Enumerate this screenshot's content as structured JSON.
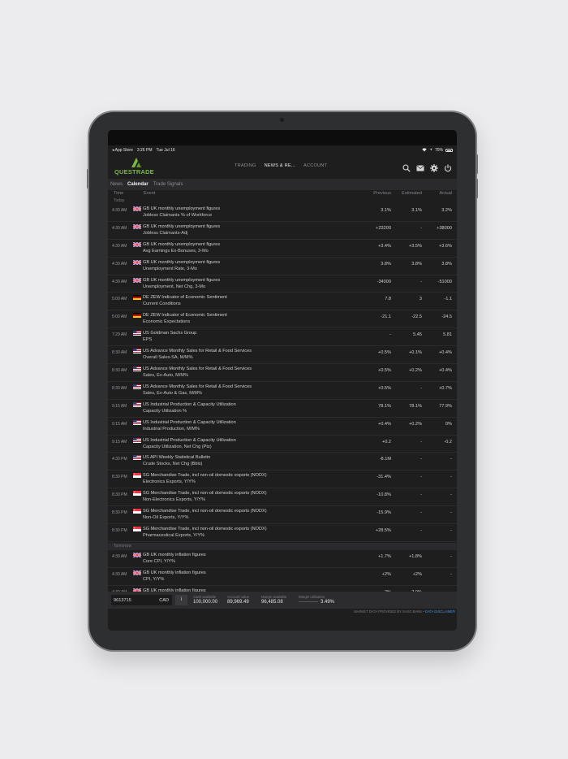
{
  "status": {
    "back_app": "◂ App Store",
    "time": "3:26 PM",
    "date": "Tue Jul 16",
    "battery": "75%"
  },
  "brand": {
    "logo_text": "QUESTRADE",
    "accent": "#7ab93e"
  },
  "nav": {
    "trading": "TRADING",
    "news": "NEWS & RE...",
    "account": "ACCOUNT"
  },
  "icons": [
    "search-icon",
    "mail-icon",
    "gear-icon",
    "power-icon"
  ],
  "subtabs": {
    "news": "News",
    "calendar": "Calendar",
    "signals": "Trade Signals"
  },
  "columns": {
    "time": "Time",
    "event": "Event",
    "previous": "Previous",
    "estimated": "Estimated",
    "actual": "Actual"
  },
  "sections": {
    "today": "Today",
    "tomorrow": "Tomorrow"
  },
  "today_rows": [
    {
      "time": "4:30 AM",
      "flag": "uk",
      "title": "GB UK monthly unemployment figures",
      "sub": "Jobless Claimants % of Workforce",
      "previous": "3.1%",
      "estimated": "3.1%",
      "actual": "3.2%"
    },
    {
      "time": "4:30 AM",
      "flag": "uk",
      "title": "GB UK monthly unemployment figures",
      "sub": "Jobless Claimants-Adj",
      "previous": "+23200",
      "estimated": "-",
      "actual": "+38000"
    },
    {
      "time": "4:30 AM",
      "flag": "uk",
      "title": "GB UK monthly unemployment figures",
      "sub": "Avg Earnings Ex-Bonuses, 3-Mo",
      "previous": "+3.4%",
      "estimated": "+3.5%",
      "actual": "+3.6%"
    },
    {
      "time": "4:30 AM",
      "flag": "uk",
      "title": "GB UK monthly unemployment figures",
      "sub": "Unemployment Rate, 3-Mo",
      "previous": "3.8%",
      "estimated": "3.8%",
      "actual": "3.8%"
    },
    {
      "time": "4:30 AM",
      "flag": "uk",
      "title": "GB UK monthly unemployment figures",
      "sub": "Unemployment, Net Chg, 3-Mo",
      "previous": "-34000",
      "estimated": "-",
      "actual": "-51000"
    },
    {
      "time": "5:00 AM",
      "flag": "de",
      "title": "DE ZEW Indicator of Economic Sentiment",
      "sub": "Current Conditions",
      "previous": "7.8",
      "estimated": "3",
      "actual": "-1.1"
    },
    {
      "time": "5:00 AM",
      "flag": "de",
      "title": "DE ZEW Indicator of Economic Sentiment",
      "sub": "Economic Expectations",
      "previous": "-21.1",
      "estimated": "-22.5",
      "actual": "-24.5"
    },
    {
      "time": "7:29 AM",
      "flag": "us",
      "title": "US Goldman Sachs Group",
      "sub": "EPS",
      "previous": "-",
      "estimated": "5.45",
      "actual": "5.81"
    },
    {
      "time": "8:30 AM",
      "flag": "us",
      "title": "US Advance Monthly Sales for Retail & Food Services",
      "sub": "Overall Sales-SA, M/M%",
      "previous": "+0.5%",
      "estimated": "+0.1%",
      "actual": "+0.4%"
    },
    {
      "time": "8:30 AM",
      "flag": "us",
      "title": "US Advance Monthly Sales for Retail & Food Services",
      "sub": "Sales, Ex-Auto, M/M%",
      "previous": "+0.5%",
      "estimated": "+0.2%",
      "actual": "+0.4%"
    },
    {
      "time": "8:30 AM",
      "flag": "us",
      "title": "US Advance Monthly Sales for Retail & Food Services",
      "sub": "Sales, Ex-Auto & Gas, M/M%",
      "previous": "+0.5%",
      "estimated": "-",
      "actual": "+0.7%"
    },
    {
      "time": "9:15 AM",
      "flag": "us",
      "title": "US Industrial Production & Capacity Utilization",
      "sub": "Capacity Utilization %",
      "previous": "78.1%",
      "estimated": "78.1%",
      "actual": "77.9%"
    },
    {
      "time": "9:15 AM",
      "flag": "us",
      "title": "US Industrial Production & Capacity Utilization",
      "sub": "Industrial Production, M/M%",
      "previous": "+0.4%",
      "estimated": "+0.2%",
      "actual": "0%"
    },
    {
      "time": "9:15 AM",
      "flag": "us",
      "title": "US Industrial Production & Capacity Utilization",
      "sub": "Capacity Utilization, Net Chg (Pts)",
      "previous": "+0.2",
      "estimated": "-",
      "actual": "-0.2"
    },
    {
      "time": "4:30 PM",
      "flag": "us",
      "title": "US API Weekly Statistical Bulletin",
      "sub": "Crude Stocks, Net Chg (Bbls)",
      "previous": "-8.1M",
      "estimated": "-",
      "actual": "-"
    },
    {
      "time": "8:30 PM",
      "flag": "sg",
      "title": "SG Merchandise Trade, incl non-oil domestic exports (NODX)",
      "sub": "Electronics Exports, Y/Y%",
      "previous": "-31.4%",
      "estimated": "-",
      "actual": "-"
    },
    {
      "time": "8:30 PM",
      "flag": "sg",
      "title": "SG Merchandise Trade, incl non-oil domestic exports (NODX)",
      "sub": "Non-Electronics Exports, Y/Y%",
      "previous": "-10.8%",
      "estimated": "-",
      "actual": "-"
    },
    {
      "time": "8:30 PM",
      "flag": "sg",
      "title": "SG Merchandise Trade, incl non-oil domestic exports (NODX)",
      "sub": "Non-Oil Exports, Y/Y%",
      "previous": "-15.9%",
      "estimated": "-",
      "actual": "-"
    },
    {
      "time": "8:30 PM",
      "flag": "sg",
      "title": "SG Merchandise Trade, incl non-oil domestic exports (NODX)",
      "sub": "Pharmaceutical Exports, Y/Y%",
      "previous": "+28.5%",
      "estimated": "-",
      "actual": "-"
    }
  ],
  "tomorrow_rows": [
    {
      "time": "4:30 AM",
      "flag": "uk",
      "title": "GB UK monthly inflation figures",
      "sub": "Core CPI, Y/Y%",
      "previous": "+1.7%",
      "estimated": "+1.8%",
      "actual": "-"
    },
    {
      "time": "4:30 AM",
      "flag": "uk",
      "title": "GB UK monthly inflation figures",
      "sub": "CPI, Y/Y%",
      "previous": "+2%",
      "estimated": "+2%",
      "actual": "-"
    },
    {
      "time": "4:30 AM",
      "flag": "uk",
      "title": "GB UK monthly inflation figures",
      "sub": "",
      "previous": "-2%",
      "estimated": "-2.0%",
      "actual": ""
    }
  ],
  "footer": {
    "account_number": "9613715",
    "currency": "CAD",
    "info": "i",
    "cash_label": "Cash available",
    "cash_value": "100,000.00",
    "account_value_label": "Account value",
    "account_value": "89,969.49",
    "margin_label": "Margin available",
    "margin_value": "96,485.08",
    "util_label": "Margin utilisation",
    "util_value": "3.49%"
  },
  "disclaimer": {
    "text": "MARKET DATA PROVIDED BY SAXO BANK • ",
    "link": "DATA DISCLAIMER"
  }
}
